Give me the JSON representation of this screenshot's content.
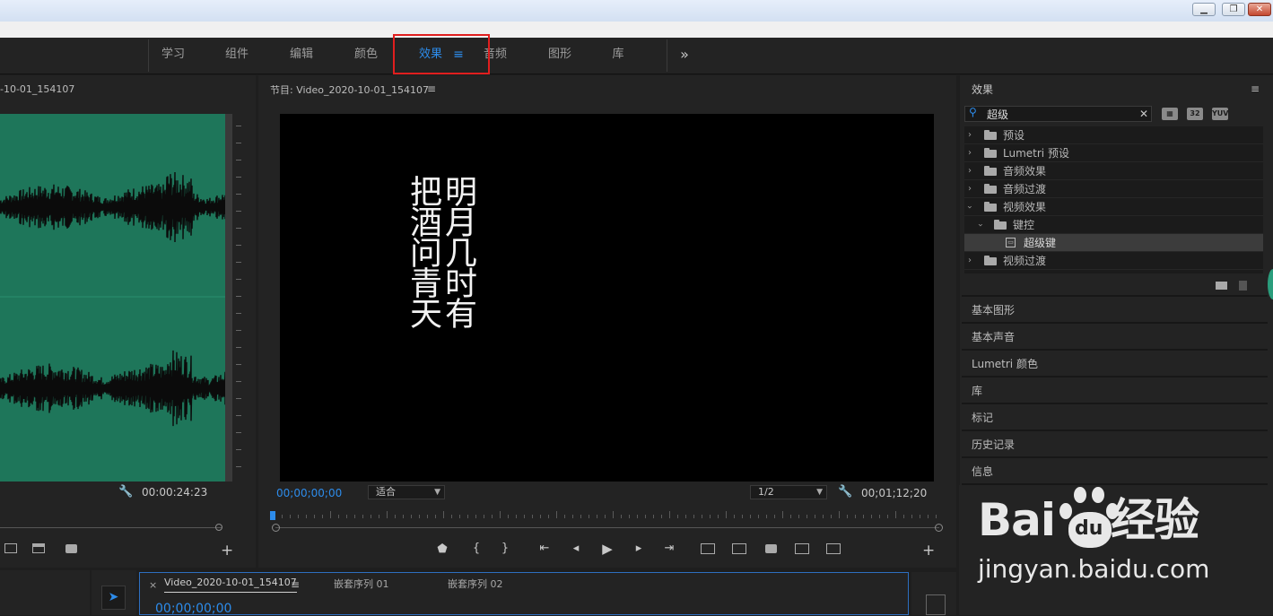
{
  "window": {
    "minimize": "▁",
    "restore": "❐",
    "close": "✕"
  },
  "workspace_tabs": [
    "学习",
    "组件",
    "编辑",
    "颜色",
    "效果",
    "音频",
    "图形",
    "库"
  ],
  "workspace_active_menu": "≡",
  "workspace_overflow": "»",
  "source": {
    "title": "-10-01_154107",
    "menu": "≡",
    "timecode": "00:00:24:23",
    "wrench": "🔧"
  },
  "program": {
    "title": "节目: Video_2020-10-01_154107",
    "menu": "≡",
    "timecode_current": "00;00;00;00",
    "fit": "适合",
    "resolution": "1/2",
    "timecode_duration": "00;01;12;20",
    "poem_right": "明月几时有",
    "poem_left": "把酒问青天"
  },
  "effects": {
    "title": "效果",
    "menu": "≡",
    "search_value": "超级",
    "clear": "✕",
    "badges": [
      "32",
      "YUV"
    ],
    "tree": [
      {
        "label": "预设"
      },
      {
        "label": "Lumetri 预设"
      },
      {
        "label": "音频效果"
      },
      {
        "label": "音频过渡"
      },
      {
        "label": "视频效果"
      },
      {
        "label": "键控"
      },
      {
        "label": "超级键"
      },
      {
        "label": "视频过渡"
      }
    ],
    "sections": [
      "基本图形",
      "基本声音",
      "Lumetri 颜色",
      "库",
      "标记",
      "历史记录",
      "信息"
    ]
  },
  "timeline": {
    "close": "×",
    "tabs": [
      "Video_2020-10-01_154107",
      "嵌套序列 01",
      "嵌套序列 02"
    ],
    "menu": "≡",
    "timecode": "00;00;00;00"
  },
  "watermark": {
    "logo_left": "Bai",
    "logo_mid": "du",
    "logo_right": "经验",
    "url": "jingyan.baidu.com"
  }
}
